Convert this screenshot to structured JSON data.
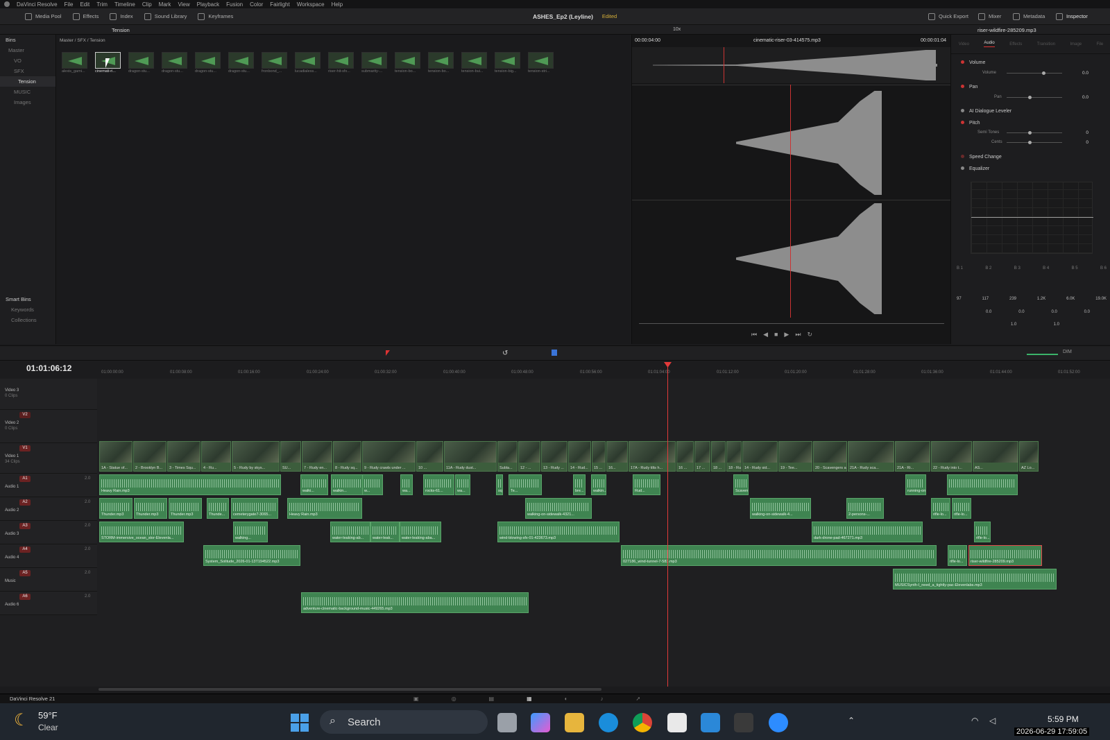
{
  "menubar": {
    "app": "DaVinci Resolve",
    "items": [
      "File",
      "Edit",
      "Trim",
      "Timeline",
      "Clip",
      "Mark",
      "View",
      "Playback",
      "Fusion",
      "Color",
      "Fairlight",
      "Workspace",
      "Help"
    ]
  },
  "toolbar": {
    "media_pool": "Media Pool",
    "effects": "Effects",
    "index": "Index",
    "sound_library": "Sound Library",
    "keyframes": "Keyframes",
    "project": "ASHES_Ep2 (Leyline)",
    "edited": "Edited",
    "quick_export": "Quick Export",
    "mixer": "Mixer",
    "metadata": "Metadata",
    "inspector": "Inspector"
  },
  "subbar": {
    "bin_title": "Tension",
    "zoom": "10x",
    "clip_name": "riser-wildfire-285209.mp3"
  },
  "bins": {
    "header": "Bins",
    "items": [
      "Master",
      "VO",
      "SFX",
      "Tension",
      "MUSIC",
      "Images"
    ],
    "smart": "Smart Bins",
    "keywords": "Keywords",
    "collections": "Collections"
  },
  "pool": {
    "path": "Master / SFX / Tension",
    "clips": [
      "alexis_gami...",
      "cinemati-ri...",
      "dragon-stu...",
      "dragon-stu...",
      "dragon-stu...",
      "dragon-stu...",
      "fronbond_...",
      "lucadialess...",
      "riser-hit-sfx...",
      "submarity-...",
      "tension-bo...",
      "tension-bo...",
      "tension-bui...",
      "tension-big...",
      "tension-stri..."
    ]
  },
  "viewer": {
    "tc_left": "00:00:04:00",
    "clip": "cinematic-riser-03-414575.mp3",
    "tc_right": "00:00:01:04"
  },
  "inspector": {
    "tabs": [
      "Video",
      "Audio",
      "Effects",
      "Transition",
      "Image",
      "File"
    ],
    "volume": "Volume",
    "volume_sub": "Volume",
    "volume_val": "0.0",
    "pan": "Pan",
    "pan_sub": "Pan",
    "pan_val": "0.0",
    "dialogue": "AI Dialogue Leveler",
    "pitch": "Pitch",
    "semitones": "Semi Tones",
    "semitones_val": "0",
    "cents": "Cents",
    "cents_val": "0",
    "speed": "Speed Change",
    "eq": "Equalizer",
    "bands": [
      "B 1",
      "B 2",
      "B 3",
      "B 4",
      "B 5",
      "B 6"
    ],
    "freq": [
      "97",
      "117",
      "239",
      "1.2K",
      "6.0K",
      "19.0K"
    ],
    "gain": [
      "0.0",
      "0.0",
      "0.0",
      "0.0"
    ],
    "q": [
      "1.0",
      "1.0"
    ]
  },
  "timeline": {
    "timecode": "01:01:06:12",
    "ruler": [
      "01:00:00:00",
      "01:00:08:00",
      "01:00:16:00",
      "01:00:24:00",
      "01:00:32:00",
      "01:00:40:00",
      "01:00:48:00",
      "01:00:56:00",
      "01:01:04:00",
      "01:01:12:00",
      "01:01:20:00",
      "01:01:28:00",
      "01:01:36:00",
      "01:01:44:00",
      "01:01:52:00"
    ],
    "dim": "DIM"
  },
  "tracks": {
    "video": [
      {
        "badge": "",
        "name": "Video 3",
        "count": "0 Clips"
      },
      {
        "badge": "V2",
        "name": "Video 2",
        "count": "0 Clips"
      },
      {
        "badge": "V1",
        "name": "Video 1",
        "count": "34 Clips"
      }
    ],
    "audio": [
      {
        "badge": "A1",
        "name": "Audio 1",
        "level": "2.0"
      },
      {
        "badge": "A2",
        "name": "Audio 2",
        "level": "2.0"
      },
      {
        "badge": "A3",
        "name": "Audio 3",
        "level": "2.0"
      },
      {
        "badge": "A4",
        "name": "Audio 4",
        "level": "2.0"
      },
      {
        "badge": "A5",
        "name": "Music",
        "level": "2.0"
      },
      {
        "badge": "A6",
        "name": "Audio 6",
        "level": "2.0"
      }
    ],
    "v1_clips": [
      "1A - Statue of...",
      "2 - Brooklyn B...",
      "3 - Times Squ...",
      "4 - Ru...",
      "5 - Rudy by skys...",
      "SU...",
      "7 - Rudy en...",
      "8 - Rudy sq...",
      "9 - Rudy crawls under ...",
      "10 ...",
      "11A - Rudy dust...",
      "Subla...",
      "12 - ...",
      "13 - Rudy ...",
      "14 - Rud...",
      "15 ...",
      "16...",
      "17A - Rudy tilts h...",
      "16 ...",
      "17 ...",
      "18 ...",
      "18 - Rudy leave...",
      "14 - Rudy sid...",
      "19 - Tee...",
      "20 - Scavengers appr...",
      "21A - Rudy sca...",
      "21A - Ri...",
      "22 - Rudy into t...",
      "AS...",
      "AZ Lo..."
    ],
    "a1": [
      "Heavy Rain.mp3",
      "walki...",
      "walkin...",
      "w...",
      "wa...",
      "rocks-61...",
      "wa...",
      "squeaky-me...",
      "Te...",
      "bre...",
      "walkin...",
      "Rud...",
      "Scaven...",
      "running-on-concrete-2684..."
    ],
    "a2": [
      "Thunder.mp3",
      "Thunder.mp3",
      "Thunder.mp3",
      "Thunde...",
      "cemeterygate7-3065...",
      "Heavy Rain.mp3",
      "walking-on-sidewalk-4321...",
      "walking-on-sidewalk-4...",
      "2-persons-...",
      "rifle-lo...",
      "rifle-lo..."
    ],
    "a3": [
      "STORM-immersive_ocean_stor-Elevenla...",
      "walking...",
      "water-leaking-ab...",
      "water-leak...",
      "water-leaking-aba...",
      "wind-blowing-sfx-01-423673.mp3",
      "dark-drone-pad-467271.mp3",
      "rifle-lo..."
    ],
    "a4": [
      "System_Solitude_2026-01-13T194522.mp3",
      "027186_wind-tunnel-7-583.mp3",
      "rifle-lo...",
      "riser-wildfire-285209.mp3"
    ],
    "a5": [
      "MUSICSynth-I_need_a_tightly-pac-Elevenlabs.mp3"
    ],
    "a6": [
      "adventure-cinematic-background-music-449265.mp3"
    ]
  },
  "status": {
    "app": "DaVinci Resolve 21"
  },
  "taskbar": {
    "temp": "59°F",
    "weather": "Clear",
    "search": "Search",
    "time": "5:59 PM",
    "date": "2026-06-29 17:59:05"
  }
}
